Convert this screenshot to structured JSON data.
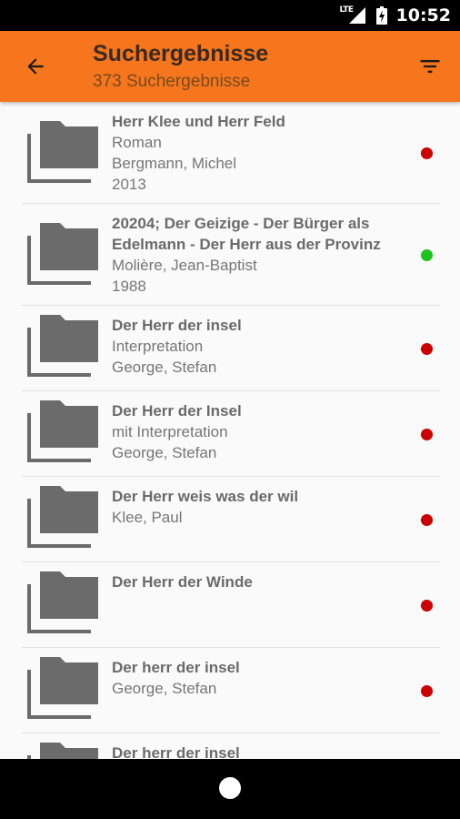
{
  "status_bar": {
    "network_label": "LTE",
    "time": "10:52"
  },
  "app_bar": {
    "title": "Suchergebnisse",
    "subtitle": "373 Suchergebnisse",
    "back_icon": "arrow-back-icon",
    "filter_icon": "filter-list-icon",
    "color": "#f5761d"
  },
  "status_colors": {
    "red": "#cc0000",
    "green": "#1ec31e"
  },
  "results": [
    {
      "title": "Herr Klee und Herr Feld",
      "lines": [
        "Roman",
        "Bergmann, Michel",
        "2013"
      ],
      "status": "red"
    },
    {
      "title": "20204; Der Geizige - Der Bürger als Edelmann - Der Herr aus der Provinz",
      "lines": [
        "Molière, Jean-Baptist",
        "1988"
      ],
      "status": "green"
    },
    {
      "title": "Der Herr der insel",
      "lines": [
        "Interpretation",
        "George, Stefan"
      ],
      "status": "red"
    },
    {
      "title": "Der Herr der Insel",
      "lines": [
        "mit Interpretation",
        "George, Stefan"
      ],
      "status": "red"
    },
    {
      "title": "Der Herr weis was der wil",
      "lines": [
        "Klee, Paul"
      ],
      "status": "red"
    },
    {
      "title": "Der Herr der Winde",
      "lines": [],
      "status": "red"
    },
    {
      "title": "Der herr der insel",
      "lines": [
        "George, Stefan"
      ],
      "status": "red"
    },
    {
      "title": "Der herr der insel",
      "lines": [],
      "status": "red"
    }
  ]
}
